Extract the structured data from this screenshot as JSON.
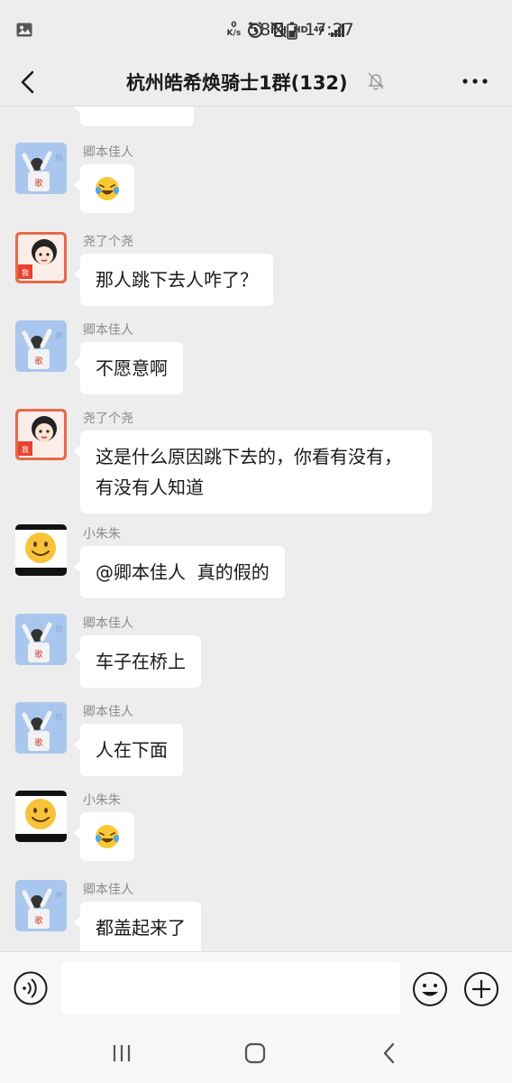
{
  "status_bar": {
    "speed_value": "0",
    "speed_unit": "K/s",
    "hd": "HD",
    "network": "4G",
    "battery": "58%",
    "time": "17:27",
    "icons": [
      "gallery-icon",
      "alarm-icon",
      "vibrate-icon",
      "signal-icon"
    ]
  },
  "header": {
    "title": "杭州皓希焕骑士1群(132)",
    "icons": [
      "back-icon",
      "mute-bell-icon",
      "more-icon"
    ]
  },
  "messages": [
    {
      "sender": "卿本佳人",
      "type": "emoji",
      "emoji": "laughing-crying-face",
      "avatar": "avatar-qingbenjiaren"
    },
    {
      "sender": "尧了个尧",
      "type": "text",
      "text": "那人跳下去人咋了？",
      "avatar": "avatar-yaolegeyao"
    },
    {
      "sender": "卿本佳人",
      "type": "text",
      "text": "不愿意啊",
      "avatar": "avatar-qingbenjiaren"
    },
    {
      "sender": "尧了个尧",
      "type": "text",
      "text": "这是什么原因跳下去的，你看有没有，有没有人知道",
      "avatar": "avatar-yaolegeyao"
    },
    {
      "sender": "小朱朱",
      "type": "text",
      "text": "@卿本佳人  真的假的",
      "avatar": "avatar-xiaozhuzhu"
    },
    {
      "sender": "卿本佳人",
      "type": "text",
      "text": "车子在桥上",
      "avatar": "avatar-qingbenjiaren"
    },
    {
      "sender": "卿本佳人",
      "type": "text",
      "text": "人在下面",
      "avatar": "avatar-qingbenjiaren"
    },
    {
      "sender": "小朱朱",
      "type": "emoji",
      "emoji": "laughing-crying-face",
      "avatar": "avatar-xiaozhuzhu"
    },
    {
      "sender": "卿本佳人",
      "type": "text",
      "text": "都盖起来了",
      "avatar": "avatar-qingbenjiaren"
    }
  ],
  "input_bar": {
    "icons": [
      "voice-icon",
      "emoji-icon",
      "plus-icon"
    ],
    "field_value": ""
  },
  "system_nav": {
    "icons": [
      "recent-apps-icon",
      "home-icon",
      "back-nav-icon"
    ]
  },
  "colors": {
    "background": "#ededed",
    "bubble": "#ffffff",
    "sender_text": "#8a8a8a"
  }
}
